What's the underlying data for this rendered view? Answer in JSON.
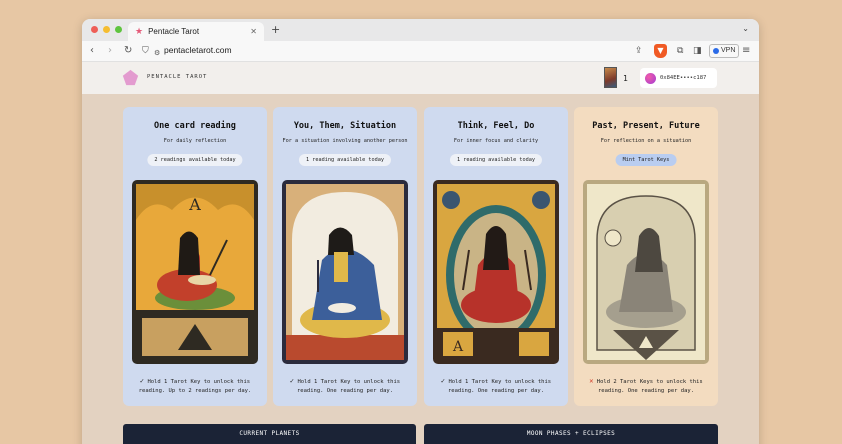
{
  "browser": {
    "tab_title": "Pentacle Tarot",
    "new_tab": "+",
    "url": "pentacletarot.com",
    "vpn_label": "VPN"
  },
  "header": {
    "brand": "PENTACLE TAROT",
    "card_count": "1",
    "wallet": "0x84EE••••c187",
    "logo_color": "#e39bcf"
  },
  "cards": [
    {
      "title": "One card reading",
      "subtitle": "For daily reflection",
      "pill": "2 readings available today",
      "footer": "Hold 1 Tarot Key to unlock this reading. Up to 2 readings per day.",
      "status": "ok",
      "bg": "#cfdaef"
    },
    {
      "title": "You, Them, Situation",
      "subtitle": "For a situation involving another person",
      "pill": "1 reading available today",
      "footer": "Hold 1 Tarot Key to unlock this reading. One reading per day.",
      "status": "ok",
      "bg": "#cfdaef"
    },
    {
      "title": "Think, Feel, Do",
      "subtitle": "For inner focus and clarity",
      "pill": "1 reading available today",
      "footer": "Hold 1 Tarot Key to unlock this reading. One reading per day.",
      "status": "ok",
      "bg": "#cfdaef"
    },
    {
      "title": "Past, Present, Future",
      "subtitle": "For reflection on a situation",
      "pill": "Mint Tarot Keys",
      "footer": "Hold 2 Tarot Keys to unlock this reading. One reading per day.",
      "status": "locked",
      "bg": "#f3dcc0"
    }
  ],
  "status_icons": {
    "ok": "✓",
    "locked": "✕"
  },
  "panels": {
    "left": "CURRENT PLANETS",
    "right": "MOON PHASES + ECLIPSES"
  }
}
